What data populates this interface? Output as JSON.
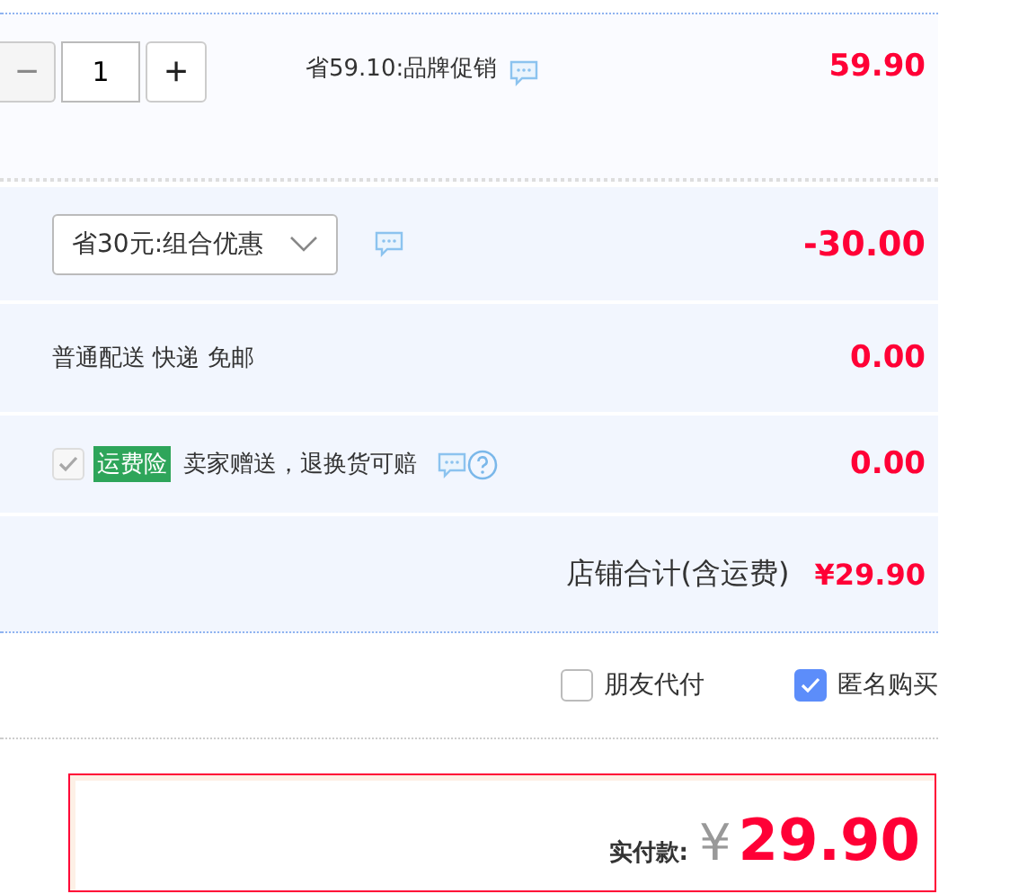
{
  "item": {
    "quantity": "1",
    "minus_disabled": true,
    "minus": "−",
    "plus": "+",
    "promo": "省59.10:品牌促销",
    "price": "59.90"
  },
  "discount": {
    "selected_option": "省30元:组合优惠",
    "amount": "-30.00"
  },
  "shipping": {
    "label": "普通配送 快递 免邮",
    "amount": "0.00"
  },
  "insurance": {
    "checked": true,
    "disabled": true,
    "tag": "运费险",
    "text": "卖家赠送，退换货可赔",
    "amount": "0.00"
  },
  "store_total": {
    "label": "店铺合计(含运费)",
    "amount": "¥29.90"
  },
  "options": [
    {
      "label": "朋友代付",
      "checked": false
    },
    {
      "label": "匿名购买",
      "checked": true
    }
  ],
  "payment": {
    "label": "实付款:",
    "currency": "¥",
    "amount": "29.90"
  }
}
